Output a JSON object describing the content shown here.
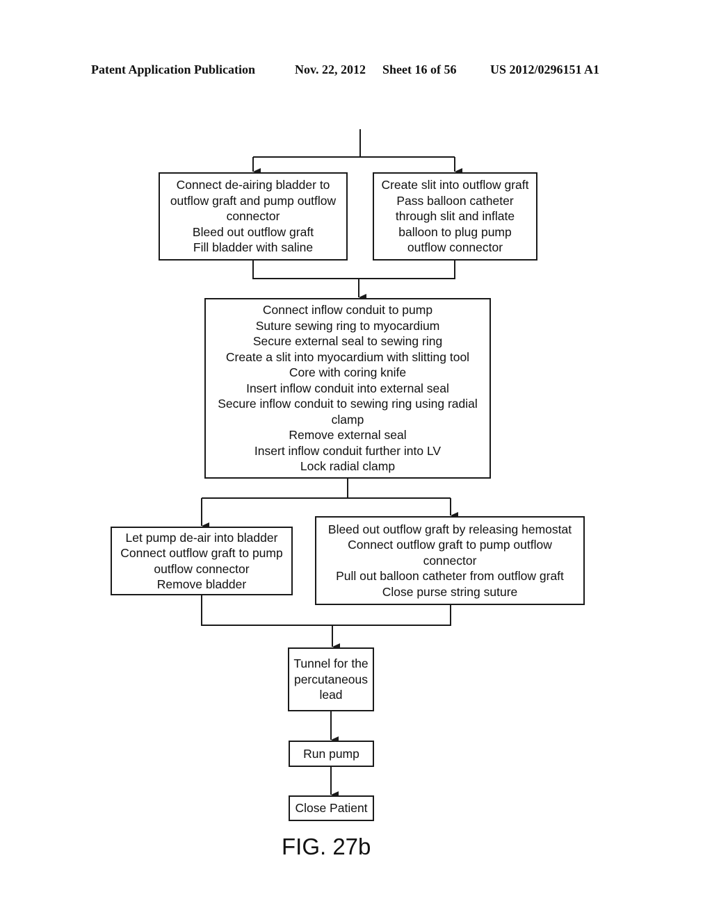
{
  "header": {
    "publication": "Patent Application Publication",
    "date": "Nov. 22, 2012",
    "sheet": "Sheet 16 of 56",
    "patent_number": "US 2012/0296151 A1"
  },
  "flowchart": {
    "boxes": [
      {
        "id": "deairing-bladder",
        "lines": [
          "Connect de-airing bladder to",
          "outflow graft and pump outflow",
          "connector",
          "Bleed out outflow graft",
          "Fill bladder with saline"
        ]
      },
      {
        "id": "balloon-catheter",
        "lines": [
          "Create slit into outflow graft",
          "Pass balloon catheter",
          "through slit and inflate",
          "balloon to plug pump",
          "outflow connector"
        ]
      },
      {
        "id": "inflow-conduit",
        "lines": [
          "Connect inflow conduit to pump",
          "Suture sewing ring to myocardium",
          "Secure external seal to sewing ring",
          "Create a slit into myocardium with slitting tool",
          "Core with coring knife",
          "Insert inflow conduit into external seal",
          "Secure inflow conduit to sewing ring using radial",
          "clamp",
          "Remove external seal",
          "Insert inflow conduit further into LV",
          "Lock radial clamp"
        ]
      },
      {
        "id": "deair-pump",
        "lines": [
          "Let pump de-air into bladder",
          "Connect outflow graft to pump",
          "outflow connector",
          "Remove bladder"
        ]
      },
      {
        "id": "release-hemostat",
        "lines": [
          "Bleed out outflow graft by releasing hemostat",
          "Connect outflow graft to pump outflow",
          "connector",
          "Pull out balloon catheter from outflow graft",
          "Close purse string suture"
        ]
      },
      {
        "id": "tunnel-lead",
        "lines": [
          "Tunnel for the",
          "percutaneous",
          "lead"
        ]
      },
      {
        "id": "run-pump",
        "lines": [
          "Run pump"
        ]
      },
      {
        "id": "close-patient",
        "lines": [
          "Close Patient"
        ]
      }
    ]
  },
  "figure_label": "FIG. 27b"
}
